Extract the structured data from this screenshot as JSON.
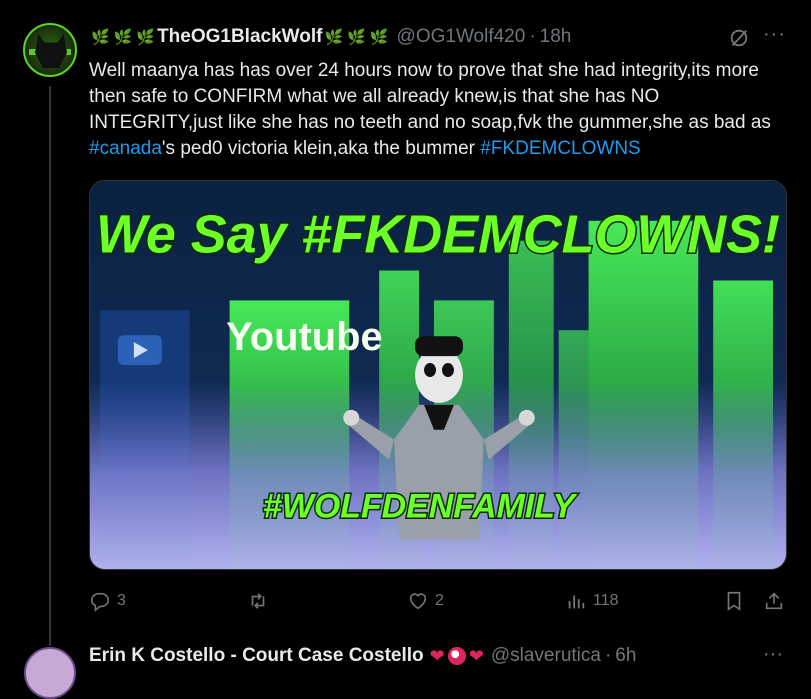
{
  "tweet": {
    "display_name": "TheOG1BlackWolf",
    "handle": "@OG1Wolf420",
    "separator": "·",
    "time": "18h",
    "text_part1": "Well maanya has has over 24 hours now to prove that she had integrity,its more then safe to CONFIRM what we all already knew,is that she has NO INTEGRITY,just like she has no teeth and no soap,fvk the gummer,she as bad as ",
    "hashtag_canada": "#canada",
    "text_part2": "'s ped0 victoria klein,aka the bummer ",
    "hashtag_fkdemclowns": "#FKDEMCLOWNS",
    "media": {
      "headline": "We Say #FKDEMCLOWNS!",
      "building_sign": "Youtube",
      "footer_tag": "#WOLFDENFAMILY"
    },
    "actions": {
      "replies": "3",
      "retweets": "",
      "likes": "2",
      "views": "118"
    },
    "icons": {
      "leaf": "herb-emoji",
      "grok": "grok-icon",
      "more": "more-icon",
      "reply": "reply-icon",
      "retweet": "retweet-icon",
      "like": "heart-icon",
      "views": "analytics-icon",
      "bookmark": "bookmark-icon",
      "share": "share-icon"
    },
    "colors": {
      "link": "#1d9bf0",
      "muted": "#71767b",
      "text": "#e7e9ea",
      "neon_green": "#6cff2a"
    }
  },
  "next_tweet": {
    "display_name": "Erin K Costello - Court Case Costello",
    "handle": "@slaverutica",
    "separator": "·",
    "time": "6h"
  }
}
